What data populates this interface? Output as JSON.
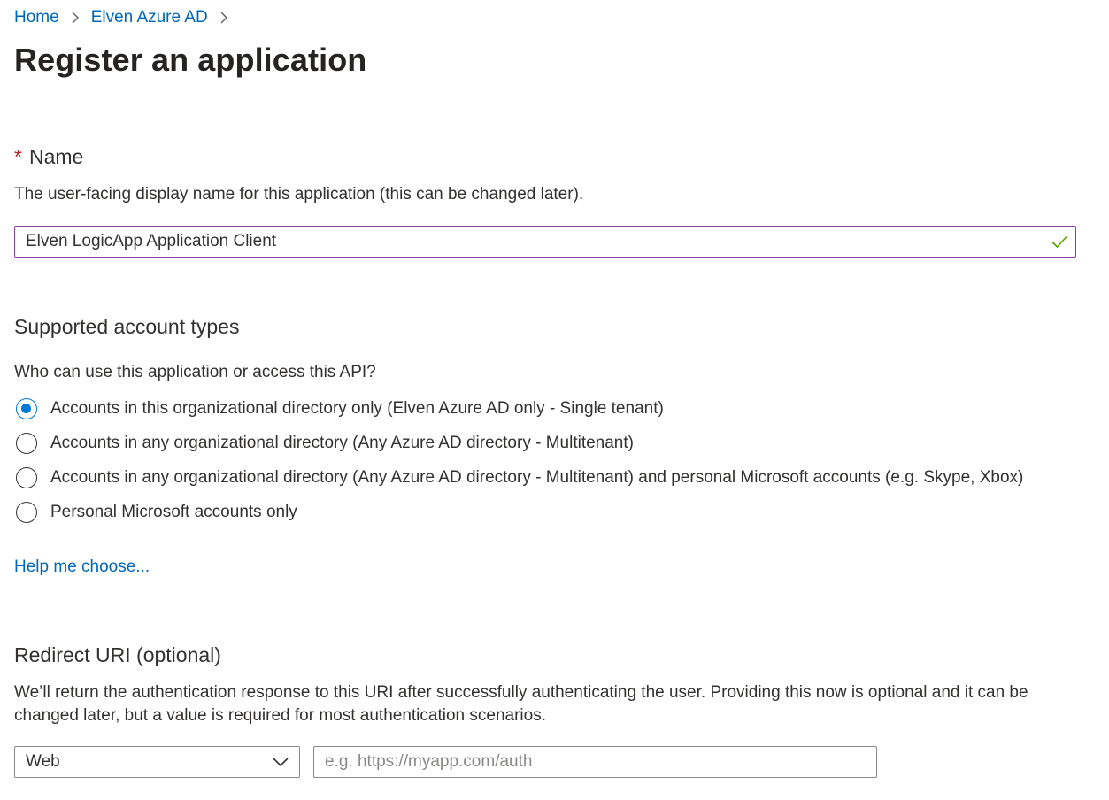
{
  "breadcrumb": {
    "items": [
      {
        "label": "Home"
      },
      {
        "label": "Elven Azure AD"
      }
    ]
  },
  "page": {
    "title": "Register an application"
  },
  "name_section": {
    "required_marker": "*",
    "heading": "Name",
    "description": "The user-facing display name for this application (this can be changed later).",
    "value": "Elven LogicApp Application Client",
    "valid_icon": "checkmark-icon"
  },
  "account_types": {
    "heading": "Supported account types",
    "question": "Who can use this application or access this API?",
    "options": [
      {
        "label": "Accounts in this organizational directory only (Elven Azure AD only - Single tenant)",
        "checked": true
      },
      {
        "label": "Accounts in any organizational directory (Any Azure AD directory - Multitenant)",
        "checked": false
      },
      {
        "label": "Accounts in any organizational directory (Any Azure AD directory - Multitenant) and personal Microsoft accounts (e.g. Skype, Xbox)",
        "checked": false
      },
      {
        "label": "Personal Microsoft accounts only",
        "checked": false
      }
    ],
    "help_link": "Help me choose..."
  },
  "redirect_uri": {
    "heading": "Redirect URI (optional)",
    "description_line1": "We’ll return the authentication response to this URI after successfully authenticating the user. Providing this now is optional and it can be",
    "description_line2": "changed later, but a value is required for most authentication scenarios.",
    "platform_value": "Web",
    "uri_placeholder": "e.g. https://myapp.com/auth"
  },
  "colors": {
    "link": "#0067b8",
    "accent": "#0078d4",
    "required": "#a4262c",
    "valid": "#57a300",
    "focus_border": "#8a3fa3"
  }
}
